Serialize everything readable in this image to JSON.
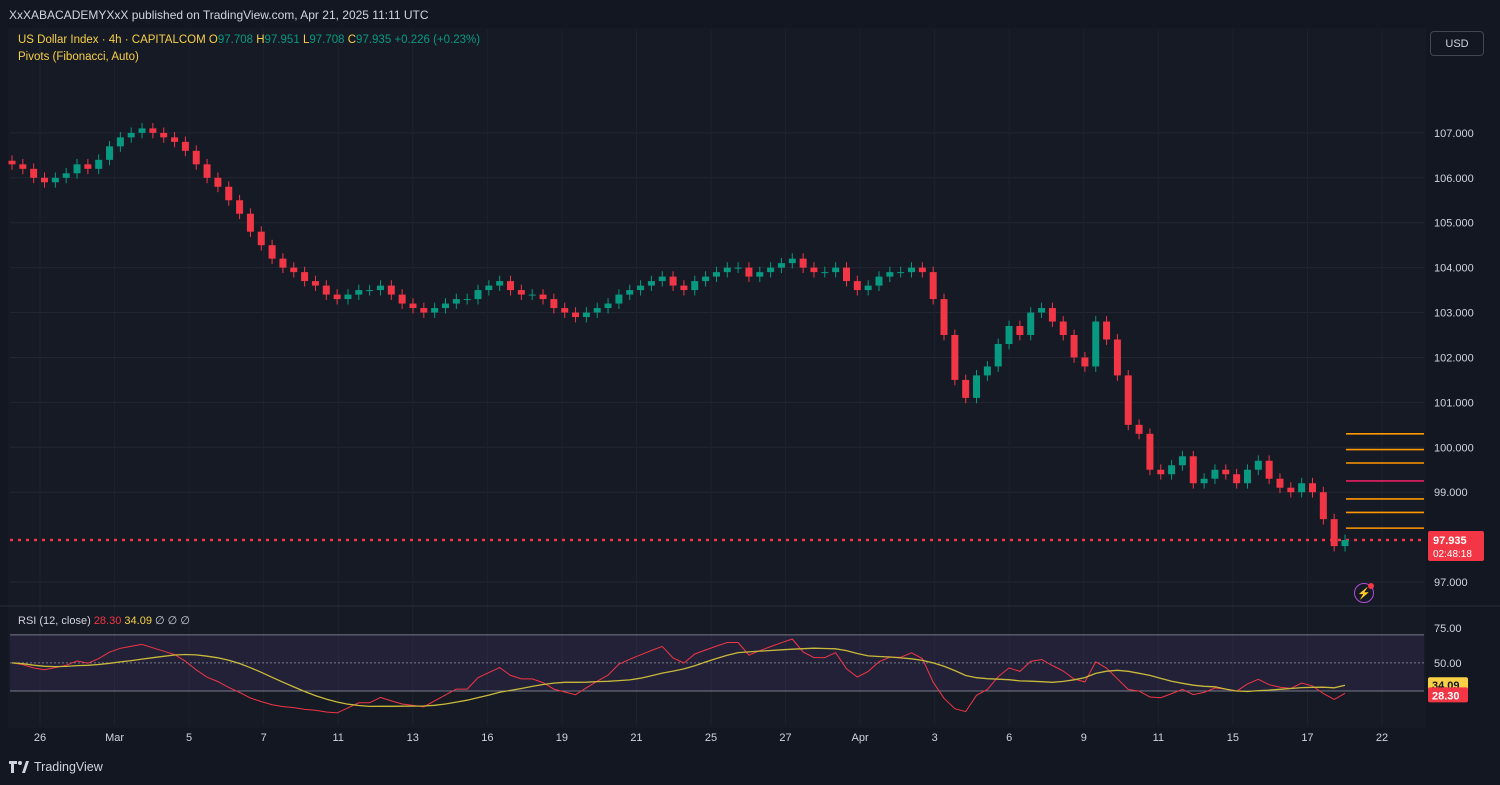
{
  "header": {
    "published": "XxXABACADEMYXxX published on TradingView.com, Apr 21, 2025 11:11 UTC"
  },
  "legend": {
    "symbol": "US Dollar Index · 4h · CAPITALCOM",
    "o_label": "O",
    "o_value": "97.708",
    "h_label": "H",
    "h_value": "97.951",
    "l_label": "L",
    "l_value": "97.708",
    "c_label": "C",
    "c_value": "97.935",
    "change": "+0.226 (+0.23%)",
    "indicator": "Pivots (Fibonacci, Auto)"
  },
  "currency_button": "USD",
  "rsi_legend": {
    "name": "RSI (12, close)",
    "rsi_value": "28.30",
    "ma_value": "34.09",
    "empty1": "∅",
    "empty2": "∅",
    "empty3": "∅"
  },
  "price_tag": {
    "price": "97.935",
    "countdown": "02:48:18"
  },
  "rsi_tags": {
    "ma": "34.09",
    "rsi": "28.30"
  },
  "footer": {
    "brand": "TradingView"
  },
  "colors": {
    "up": "#089981",
    "down": "#f23645",
    "rsi": "#f23645",
    "rsi_ma": "#c9b93a",
    "pivot_orange": "#ff9800",
    "pivot_pink": "#e91e63"
  },
  "chart_data": {
    "type": "candlestick",
    "instrument": "US Dollar Index",
    "timeframe": "4h",
    "y_ticks": [
      "107.000",
      "106.000",
      "105.000",
      "104.000",
      "103.000",
      "102.000",
      "101.000",
      "100.000",
      "99.000",
      "97.000"
    ],
    "ylim": [
      96.6,
      108.4
    ],
    "x_ticks": [
      "26",
      "Mar",
      "5",
      "7",
      "11",
      "13",
      "16",
      "19",
      "21",
      "25",
      "27",
      "Apr",
      "3",
      "6",
      "9",
      "11",
      "15",
      "17",
      "22"
    ],
    "closes": [
      106.3,
      106.2,
      106.0,
      105.9,
      106.0,
      106.1,
      106.3,
      106.2,
      106.4,
      106.7,
      106.9,
      107.0,
      107.1,
      107.0,
      106.9,
      106.8,
      106.6,
      106.3,
      106.0,
      105.8,
      105.5,
      105.2,
      104.8,
      104.5,
      104.2,
      104.0,
      103.9,
      103.7,
      103.6,
      103.4,
      103.3,
      103.4,
      103.5,
      103.5,
      103.6,
      103.4,
      103.2,
      103.1,
      103.0,
      103.1,
      103.2,
      103.3,
      103.3,
      103.5,
      103.6,
      103.7,
      103.5,
      103.4,
      103.4,
      103.3,
      103.1,
      103.0,
      102.9,
      103.0,
      103.1,
      103.2,
      103.4,
      103.5,
      103.6,
      103.7,
      103.8,
      103.6,
      103.5,
      103.7,
      103.8,
      103.9,
      104.0,
      104.0,
      103.8,
      103.9,
      104.0,
      104.1,
      104.2,
      104.0,
      103.9,
      103.9,
      104.0,
      103.7,
      103.5,
      103.6,
      103.8,
      103.9,
      103.9,
      104.0,
      103.9,
      103.3,
      102.5,
      101.5,
      101.1,
      101.6,
      101.8,
      102.3,
      102.7,
      102.5,
      103.0,
      103.1,
      102.8,
      102.5,
      102.0,
      101.8,
      102.8,
      102.4,
      101.6,
      100.5,
      100.3,
      99.5,
      99.4,
      99.6,
      99.8,
      99.2,
      99.3,
      99.5,
      99.4,
      99.2,
      99.5,
      99.7,
      99.3,
      99.1,
      99.0,
      99.2,
      99.0,
      98.4,
      97.8,
      97.935
    ],
    "pivot_levels": [
      {
        "value": 100.3,
        "color": "orange"
      },
      {
        "value": 99.95,
        "color": "orange"
      },
      {
        "value": 99.65,
        "color": "orange"
      },
      {
        "value": 99.25,
        "color": "pink"
      },
      {
        "value": 98.85,
        "color": "orange"
      },
      {
        "value": 98.55,
        "color": "orange"
      },
      {
        "value": 98.2,
        "color": "orange"
      }
    ],
    "last_price": 97.935,
    "rsi": {
      "name": "RSI (12, close)",
      "y_ticks": [
        "75.00",
        "50.00"
      ],
      "ylim": [
        15,
        82
      ],
      "bands": [
        70,
        30
      ],
      "middle": 50,
      "last_rsi": 28.3,
      "last_ma": 34.09
    }
  }
}
